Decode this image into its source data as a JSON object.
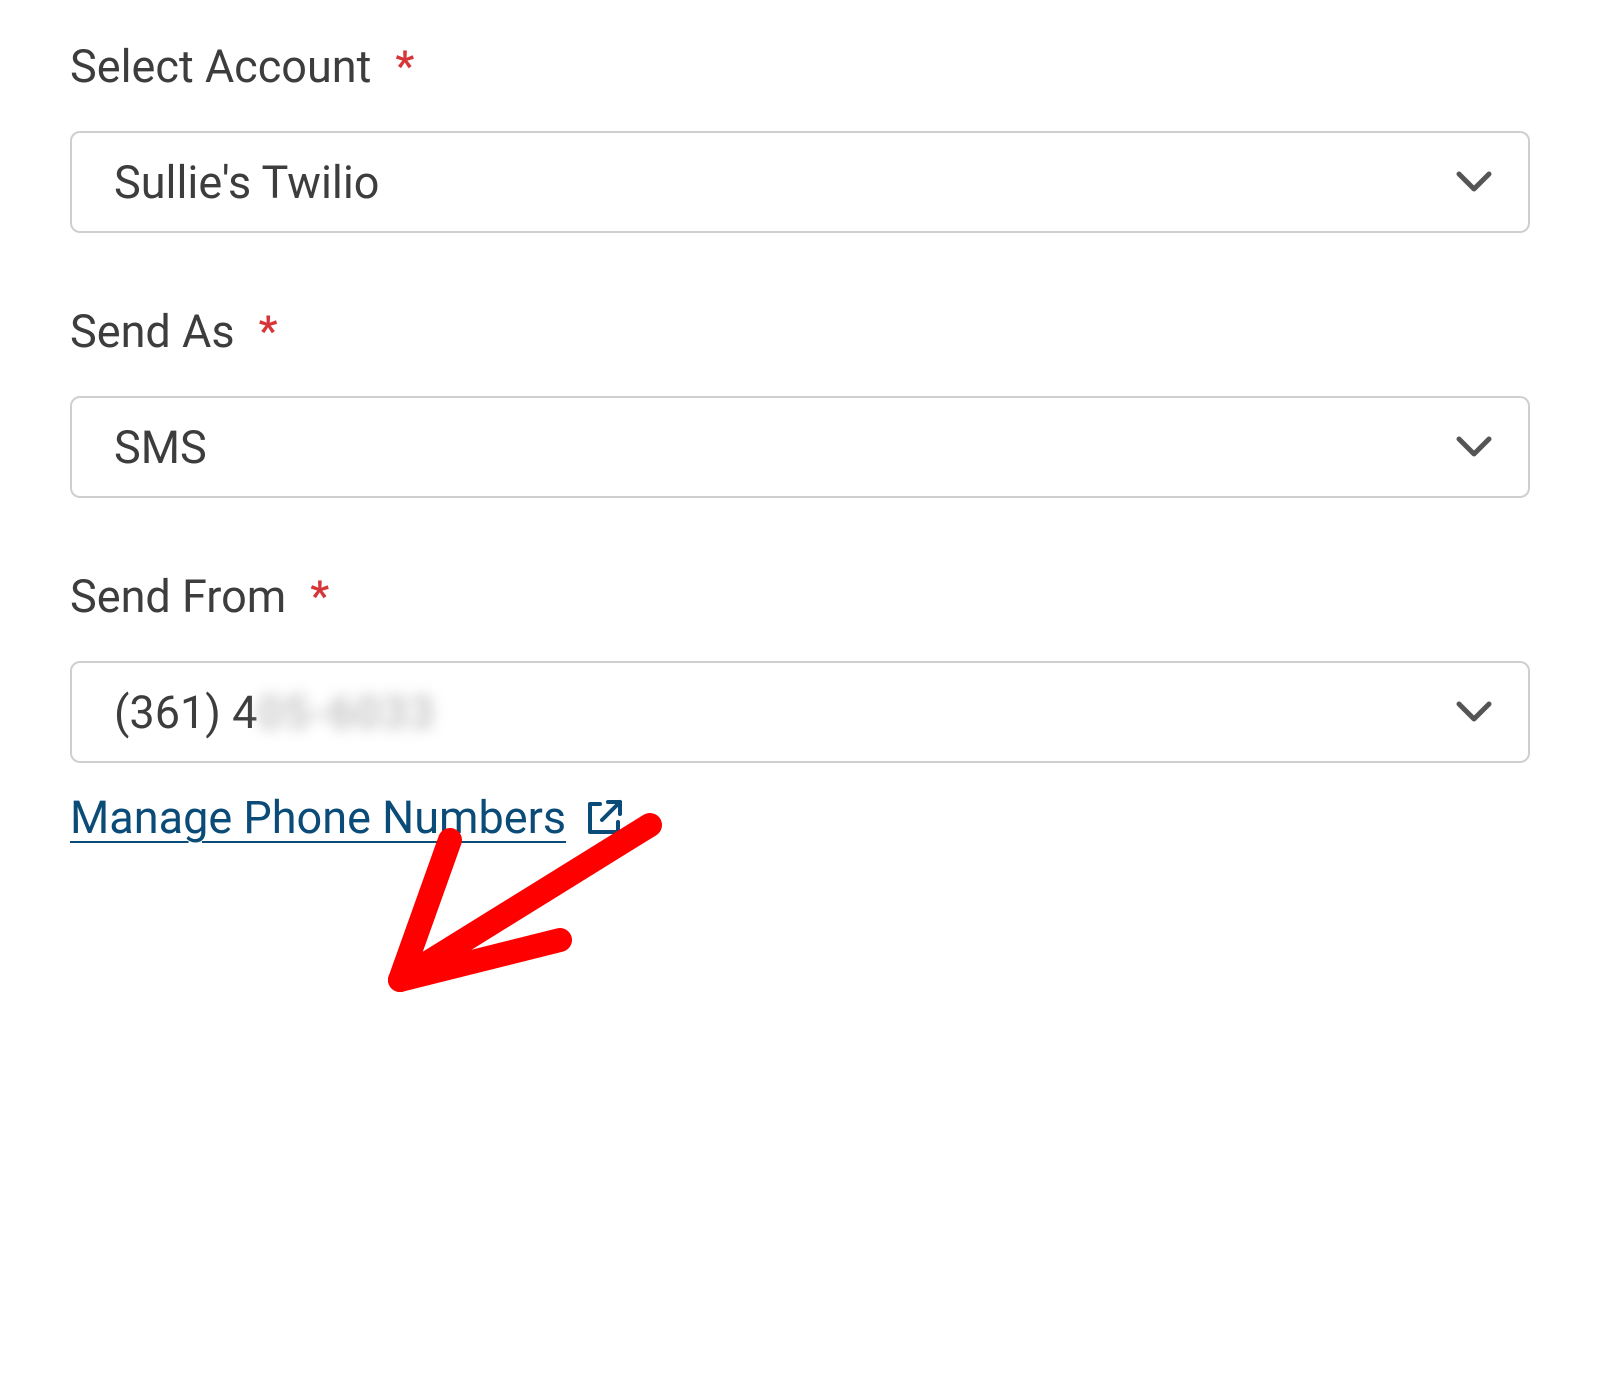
{
  "fields": {
    "select_account": {
      "label": "Select Account",
      "required": "*",
      "value": "Sullie's Twilio"
    },
    "send_as": {
      "label": "Send As",
      "required": "*",
      "value": "SMS"
    },
    "send_from": {
      "label": "Send From",
      "required": "*",
      "value_visible": "(361) 4",
      "value_blurred": "05-6033"
    }
  },
  "links": {
    "manage_phone_numbers": "Manage Phone Numbers"
  }
}
